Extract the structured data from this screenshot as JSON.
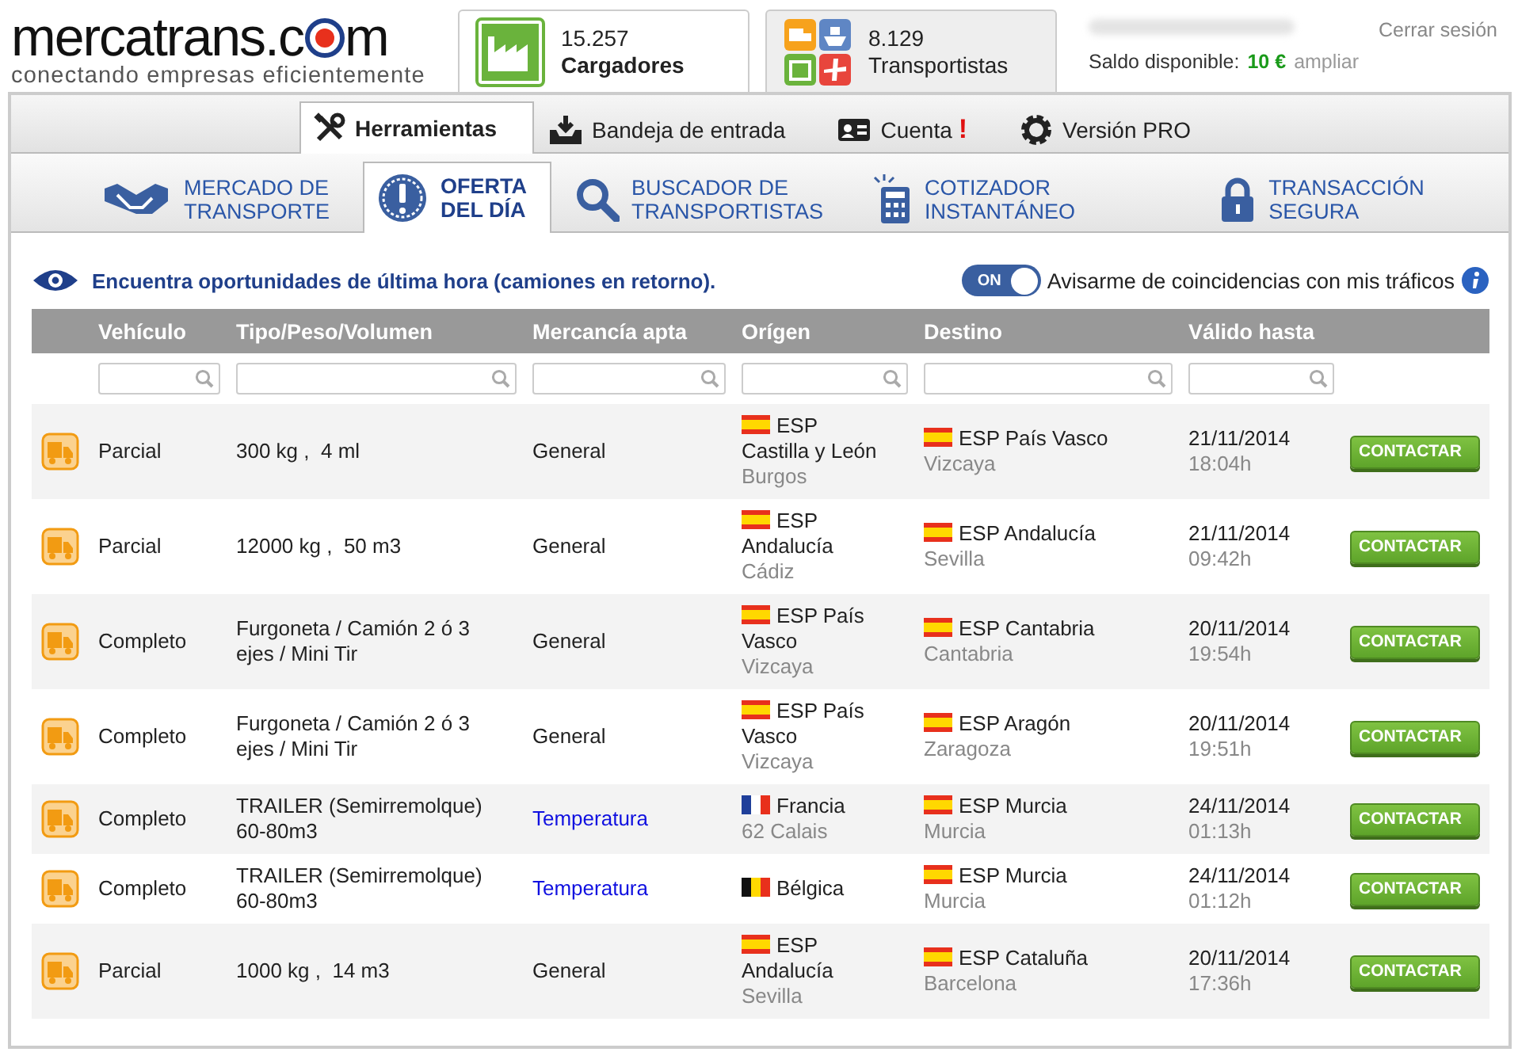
{
  "logo": {
    "text_start": "mercatrans.c",
    "text_end": "m",
    "tagline": "conectando empresas eficientemente"
  },
  "user_cards": [
    {
      "kind": "shippers",
      "count": "15.257",
      "label": "Cargadores",
      "selected": true
    },
    {
      "kind": "carriers",
      "count": "8.129",
      "label": "Transportistas",
      "selected": false
    }
  ],
  "account": {
    "logout": "Cerrar sesión",
    "balance_label": "Saldo disponible:",
    "balance": "10 €",
    "extend": "ampliar"
  },
  "main_tabs": [
    {
      "label": "Herramientas",
      "selected": true
    },
    {
      "label": "Bandeja de entrada",
      "selected": false
    },
    {
      "label": "Cuenta",
      "alert": "!",
      "selected": false
    },
    {
      "label": "Versión PRO",
      "selected": false
    }
  ],
  "sub_tabs": [
    {
      "lines": [
        "MERCADO DE",
        "TRANSPORTE"
      ],
      "selected": false
    },
    {
      "lines": [
        "OFERTA",
        "DEL DÍA"
      ],
      "selected": true
    },
    {
      "lines": [
        "BUSCADOR DE",
        "TRANSPORTISTAS"
      ],
      "selected": false
    },
    {
      "lines": [
        "COTIZADOR",
        "INSTANTÁNEO"
      ],
      "selected": false
    },
    {
      "lines": [
        "TRANSACCIÓN",
        "SEGURA"
      ],
      "selected": false
    }
  ],
  "intro": {
    "text": "Encuentra oportunidades de última hora (camiones en retorno).",
    "toggle": {
      "on": true,
      "label": "ON"
    },
    "notify_label": "Avisarme de coincidencias con mis tráficos"
  },
  "table": {
    "columns": [
      "Vehículo",
      "Tipo/Peso/Volumen",
      "Mercancía apta",
      "Orígen",
      "Destino",
      "Válido hasta"
    ],
    "rows": [
      {
        "vehicle": "Parcial",
        "type": "300 kg ,  4 ml",
        "goods": {
          "kind": "text",
          "label": "General"
        },
        "origin": {
          "kind": "es",
          "region": "ESP Castilla y León",
          "city": "Burgos"
        },
        "destination": {
          "kind": "es",
          "region": "ESP País Vasco",
          "city": "Vizcaya"
        },
        "valid": {
          "date": "21/11/2014",
          "time": "18:04h"
        },
        "action": "CONTACTAR"
      },
      {
        "vehicle": "Parcial",
        "type": "12000 kg ,  50 m3",
        "goods": {
          "kind": "text",
          "label": "General"
        },
        "origin": {
          "kind": "es",
          "region": "ESP Andalucía",
          "city": "Cádiz"
        },
        "destination": {
          "kind": "es",
          "region": "ESP Andalucía",
          "city": "Sevilla"
        },
        "valid": {
          "date": "21/11/2014",
          "time": "09:42h"
        },
        "action": "CONTACTAR"
      },
      {
        "vehicle": "Completo",
        "type": "Furgoneta / Camión 2 ó 3 ejes / Mini Tir",
        "goods": {
          "kind": "text",
          "label": "General"
        },
        "origin": {
          "kind": "es",
          "region": "ESP País Vasco",
          "city": "Vizcaya"
        },
        "destination": {
          "kind": "es",
          "region": "ESP Cantabria",
          "city": "Cantabria"
        },
        "valid": {
          "date": "20/11/2014",
          "time": "19:54h"
        },
        "action": "CONTACTAR"
      },
      {
        "vehicle": "Completo",
        "type": "Furgoneta / Camión 2 ó 3 ejes / Mini Tir",
        "goods": {
          "kind": "text",
          "label": "General"
        },
        "origin": {
          "kind": "es",
          "region": "ESP País Vasco",
          "city": "Vizcaya"
        },
        "destination": {
          "kind": "es",
          "region": "ESP Aragón",
          "city": "Zaragoza"
        },
        "valid": {
          "date": "20/11/2014",
          "time": "19:51h"
        },
        "action": "CONTACTAR"
      },
      {
        "vehicle": "Completo",
        "type": "TRAILER (Semirremolque) 60-80m3",
        "goods": {
          "kind": "link",
          "label": "Temperatura"
        },
        "origin": {
          "kind": "fr",
          "region": "Francia",
          "city": "62 Calais"
        },
        "destination": {
          "kind": "es",
          "region": "ESP Murcia",
          "city": "Murcia"
        },
        "valid": {
          "date": "24/11/2014",
          "time": "01:13h"
        },
        "action": "CONTACTAR"
      },
      {
        "vehicle": "Completo",
        "type": "TRAILER (Semirremolque) 60-80m3",
        "goods": {
          "kind": "link",
          "label": "Temperatura"
        },
        "origin": {
          "kind": "be",
          "region": "Bélgica"
        },
        "destination": {
          "kind": "es",
          "region": "ESP Murcia",
          "city": "Murcia"
        },
        "valid": {
          "date": "24/11/2014",
          "time": "01:12h"
        },
        "action": "CONTACTAR"
      },
      {
        "vehicle": "Parcial",
        "type": "1000 kg ,  14 m3",
        "goods": {
          "kind": "text",
          "label": "General"
        },
        "origin": {
          "kind": "es",
          "region": "ESP Andalucía",
          "city": "Sevilla"
        },
        "destination": {
          "kind": "es",
          "region": "ESP Cataluña",
          "city": "Barcelona"
        },
        "valid": {
          "date": "20/11/2014",
          "time": "17:36h"
        },
        "action": "CONTACTAR"
      }
    ]
  }
}
